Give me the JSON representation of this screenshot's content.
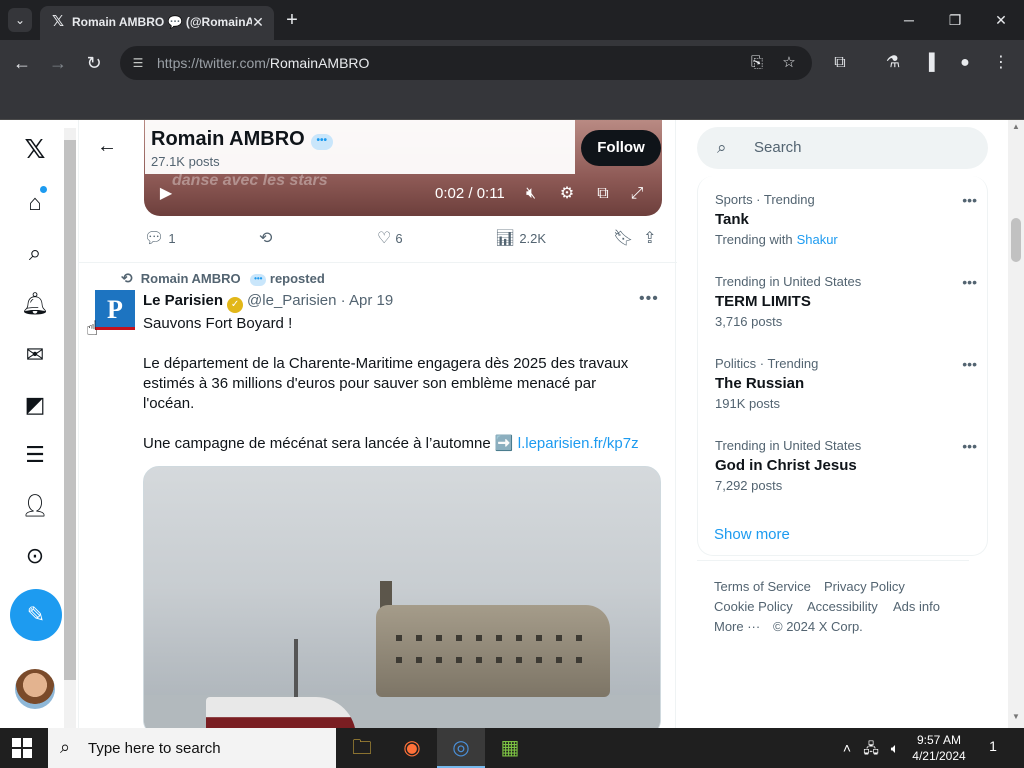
{
  "browser": {
    "tab_title": "Romain AMBRO 💬 (@RomainAMBRO",
    "url_host": "https://twitter.com/",
    "url_path": "RomainAMBRO"
  },
  "profile": {
    "name": "Romain AMBRO",
    "post_count": "27.1K posts",
    "follow_label": "Follow"
  },
  "video": {
    "time": "0:02 / 0:11",
    "watermark": "danse avec les stars"
  },
  "prev_tweet_actions": {
    "replies": "1",
    "reposts": "",
    "likes": "6",
    "views": "2.2K"
  },
  "repost": {
    "by": "Romain AMBRO",
    "label": "reposted"
  },
  "tweet": {
    "author": "Le Parisien",
    "handle": "@le_Parisien · Apr 19",
    "avatar_letter": "P",
    "line1": "Sauvons Fort Boyard !",
    "line2": "Le département de la Charente-Maritime engagera dès 2025 des travaux",
    "line3": "estimés à 36 millions d'euros pour sauver son emblème menacé par",
    "line4": "l'océan.",
    "line5": "Une campagne de mécénat sera lancée à l’automne ➡️",
    "link": "l.leparisien.fr/kp7z"
  },
  "sidebar": {
    "search_placeholder": "Search",
    "trends": [
      {
        "meta": "Sports · Trending",
        "name": "Tank",
        "sub": "Trending with",
        "sub_link": "Shakur"
      },
      {
        "meta": "Trending in United States",
        "name": "TERM LIMITS",
        "sub": "3,716 posts",
        "sub_link": ""
      },
      {
        "meta": "Politics · Trending",
        "name": "The Russian",
        "sub": "191K posts",
        "sub_link": ""
      },
      {
        "meta": "Trending in United States",
        "name": "God in Christ Jesus",
        "sub": "7,292 posts",
        "sub_link": ""
      }
    ],
    "show_more": "Show more",
    "footer": {
      "terms": "Terms of Service",
      "privacy": "Privacy Policy",
      "cookie": "Cookie Policy",
      "accessibility": "Accessibility",
      "ads": "Ads info",
      "more": "More ···",
      "copyright": "© 2024 X Corp."
    }
  },
  "taskbar": {
    "search_placeholder": "Type here to search",
    "time": "9:57 AM",
    "date": "4/21/2024",
    "notifications": "1"
  },
  "colors": {
    "accent": "#1d9bf0",
    "text": "#0f1419",
    "muted": "#536471"
  }
}
